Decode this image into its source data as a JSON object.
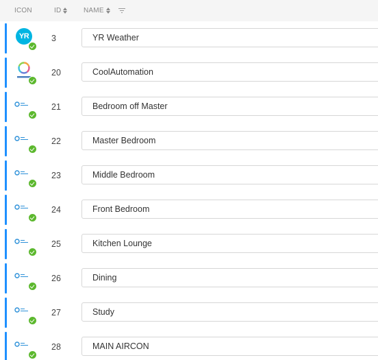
{
  "header": {
    "icon_label": "ICON",
    "id_label": "ID",
    "name_label": "NAME"
  },
  "colors": {
    "accent_bar": "#1e90ff",
    "status_ok": "#5cb82e",
    "yr_brand": "#00b5e2"
  },
  "rows": [
    {
      "id": "3",
      "name": "YR Weather",
      "icon": "yr-weather-logo-icon"
    },
    {
      "id": "20",
      "name": "CoolAutomation",
      "icon": "coolautomation-logo-icon"
    },
    {
      "id": "21",
      "name": "Bedroom off Master",
      "icon": "coolautomation-small-logo-icon"
    },
    {
      "id": "22",
      "name": "Master Bedroom",
      "icon": "coolautomation-small-logo-icon"
    },
    {
      "id": "23",
      "name": "Middle Bedroom",
      "icon": "coolautomation-small-logo-icon"
    },
    {
      "id": "24",
      "name": "Front Bedroom",
      "icon": "coolautomation-small-logo-icon"
    },
    {
      "id": "25",
      "name": "Kitchen Lounge",
      "icon": "coolautomation-small-logo-icon"
    },
    {
      "id": "26",
      "name": "Dining",
      "icon": "coolautomation-small-logo-icon"
    },
    {
      "id": "27",
      "name": "Study",
      "icon": "coolautomation-small-logo-icon"
    },
    {
      "id": "28",
      "name": "MAIN AIRCON",
      "icon": "coolautomation-small-logo-icon"
    }
  ],
  "logos": {
    "yr_text": "YR"
  }
}
